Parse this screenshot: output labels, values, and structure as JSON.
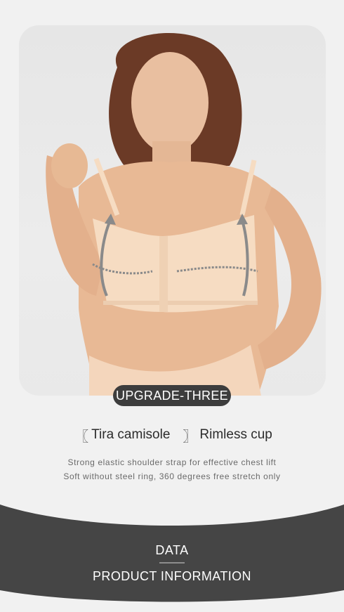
{
  "badge": {
    "label": "UPGRADE-THREE"
  },
  "feature": {
    "bracket_open": "〖",
    "bracket_close": "〗",
    "item_1": "Tira camisole",
    "item_2": "Rimless cup"
  },
  "description": {
    "line_1": "Strong elastic shoulder strap for effective chest lift",
    "line_2": "Soft without steel ring, 360 degrees free stretch only"
  },
  "footer": {
    "title": "DATA",
    "subtitle": "PRODUCT INFORMATION"
  },
  "colors": {
    "page_background": "#f1f1f1",
    "dark_band": "#454545",
    "badge": "#3d3d3d",
    "garment": "#f6dcc2"
  }
}
